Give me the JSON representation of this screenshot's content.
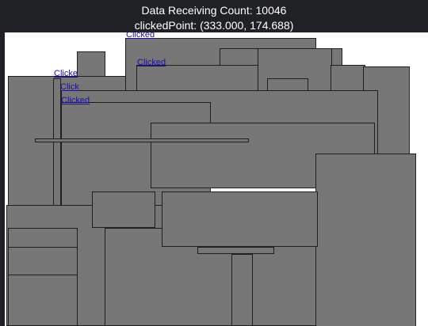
{
  "header": {
    "count_label": "Data Receiving Count: 10046",
    "clicked_point_label": "clickedPoint: (333.000, 174.688)"
  },
  "links": {
    "clicked_1": "Clicked",
    "clicked_2": "Clicked",
    "clicked_3": "Clicke",
    "clicked_4": "Click",
    "clicked_5": "Clicked"
  },
  "colors": {
    "header_bg": "#202124",
    "canvas_bg": "#ffffff",
    "rect_fill": "#777777",
    "rect_border": "#1f1f1f",
    "link_color": "#1a0dab"
  }
}
